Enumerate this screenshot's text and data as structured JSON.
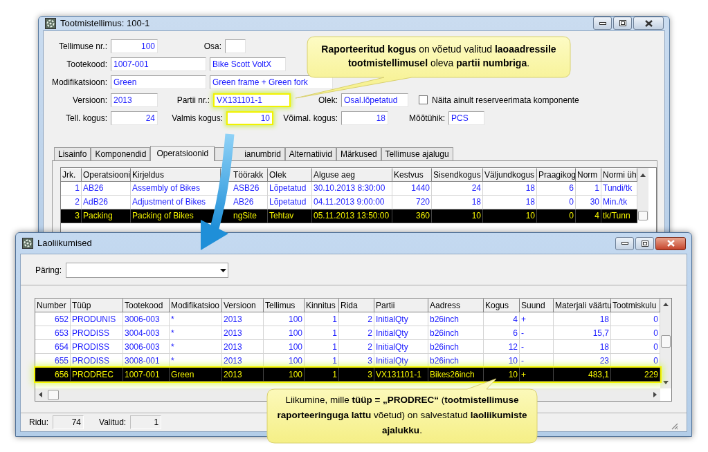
{
  "order_window": {
    "title": "Tootmistellimus: 100-1",
    "form": [
      [
        {
          "kind": "label",
          "text": "Tellimuse nr.:"
        },
        {
          "kind": "number",
          "value": "100",
          "highlighted": false
        },
        {
          "kind": "label",
          "text": "Osa:"
        },
        {
          "kind": "text",
          "highlighted": false
        }
      ],
      [
        {
          "kind": "label",
          "text": "Tootekood:"
        },
        {
          "kind": "text",
          "value": "1007-001",
          "highlighted": false
        },
        {
          "kind": "text",
          "value": "Bike Scott VoltX",
          "highlighted": false
        }
      ],
      [
        {
          "kind": "label",
          "text": "Modifikatsioon:"
        },
        {
          "kind": "text",
          "value": "Green",
          "highlighted": false
        },
        {
          "kind": "text",
          "value": "Green frame + Green fork",
          "highlighted": false
        }
      ],
      [
        {
          "kind": "label",
          "text": "Versioon:"
        },
        {
          "kind": "text",
          "value": "2013",
          "highlighted": false
        },
        {
          "kind": "label",
          "text": "Partii nr.:"
        },
        {
          "kind": "text",
          "value": "VX131101-1",
          "highlighted": true
        },
        {
          "kind": "label",
          "text": "Olek:"
        },
        {
          "kind": "text",
          "value": "Osal.lõpetatud",
          "highlighted": false
        },
        {
          "kind": "checkbox",
          "text": "Näita ainult reserveerimata komponente",
          "checked": false
        }
      ],
      [
        {
          "kind": "label",
          "text": "Tell. kogus:"
        },
        {
          "kind": "number",
          "value": "24",
          "highlighted": false
        },
        {
          "kind": "label",
          "text": "Valmis kogus:"
        },
        {
          "kind": "number",
          "value": "10",
          "highlighted": true
        },
        {
          "kind": "label",
          "text": "Võimal. kogus:"
        },
        {
          "kind": "number",
          "value": "18",
          "highlighted": false
        },
        {
          "kind": "label",
          "text": "Mõõtühik:"
        },
        {
          "kind": "text",
          "value": "PCS",
          "highlighted": false
        }
      ]
    ],
    "tabs": [
      {
        "label": "Lisainfo",
        "selected": false
      },
      {
        "label": "Komponendid",
        "selected": false
      },
      {
        "label": "Operatsioonid",
        "selected": true
      },
      {
        "label": "ianumbrid",
        "selected": false
      },
      {
        "label": "Alternatiivid",
        "selected": false
      },
      {
        "label": "Märkused",
        "selected": false
      },
      {
        "label": "Tellimuse ajalugu",
        "selected": false
      }
    ],
    "operations": {
      "columns": [
        "Jrk.",
        "Operatsiooni",
        "Kirjeldus",
        "Töörakk",
        "Olek",
        "Alguse aeg",
        "Kestvus",
        "Sisendkogus",
        "Väljundkogus",
        "Praagikog",
        "Norm",
        "Normi üh"
      ],
      "rows": [
        {
          "selected": false,
          "cells": [
            "1",
            "AB26",
            "Assembly of Bikes",
            "ASB26",
            "Lõpetatud",
            "30.10.2013 8:30:00",
            "1440",
            "24",
            "18",
            "6",
            "1",
            "Tundi/tk"
          ]
        },
        {
          "selected": false,
          "cells": [
            "2",
            "AdB26",
            "Adjustment of Bikes",
            "AB26",
            "Lõpetatud",
            "04.11.2013 9:00:00",
            "720",
            "18",
            "18",
            "0",
            "30",
            "Min./tk"
          ]
        },
        {
          "selected": true,
          "cells": [
            "3",
            "Packing",
            "Packing of Bikes",
            "ngSite",
            "Tehtav",
            "05.11.2013 13:50:00",
            "360",
            "10",
            "10",
            "0",
            "4",
            "tk/Tunn"
          ]
        }
      ]
    }
  },
  "order_callout": "**Raporteeritud kogus** on võetud valitud **laoaadressile tootmistellimusel** oleva **partii numbriga**.",
  "movements_window": {
    "title": "Laoliikumised",
    "query_label": "Päring:",
    "columns": [
      "Number",
      "Tüüp",
      "Tootekood",
      "Modifikatsioo",
      "Versioon",
      "Tellimus",
      "Kinnitus",
      "Rida",
      "Partii",
      "Aadress",
      "Kogus",
      "Suund",
      "Materjali väärtu",
      "Tootmiskulu"
    ],
    "rows": [
      {
        "selected": false,
        "highlighted": false,
        "cells": [
          "652",
          "PRODUNIS",
          "3006-003",
          "*",
          "2013",
          "100",
          "1",
          "2",
          "InitialQty",
          "b26inch",
          "4",
          "+",
          "18",
          "0"
        ]
      },
      {
        "selected": false,
        "highlighted": false,
        "cells": [
          "653",
          "PRODISS",
          "3004-003",
          "*",
          "2013",
          "100",
          "1",
          "2",
          "InitialQty",
          "b26inch",
          "6",
          "-",
          "15,7",
          "0"
        ]
      },
      {
        "selected": false,
        "highlighted": false,
        "cells": [
          "654",
          "PRODISS",
          "3006-003",
          "*",
          "2013",
          "100",
          "1",
          "2",
          "InitialQty",
          "b26inch",
          "12",
          "-",
          "18",
          "0"
        ]
      },
      {
        "selected": false,
        "highlighted": false,
        "cells": [
          "655",
          "PRODISS",
          "3008-001",
          "*",
          "2013",
          "100",
          "1",
          "3",
          "InitialQty",
          "b26inch",
          "10",
          "-",
          "23",
          "0"
        ]
      },
      {
        "selected": true,
        "highlighted": true,
        "cells": [
          "656",
          "PRODREC",
          "1007-001",
          "Green",
          "2013",
          "100",
          "1",
          "3",
          "VX131101-1",
          "Bikes26inch",
          "10",
          "+",
          "483,1",
          "229"
        ]
      }
    ],
    "status": [
      {
        "label": "Ridu:",
        "value": "74"
      },
      {
        "label": "Valitud:",
        "value": "1"
      }
    ]
  },
  "movement_callout": "Liikumine, mille **tüüp = „PRODREC“** (**tootmistellimuse raporteeringuga lattu** võetud) on salvestatud **laoliikumiste ajalukku**."
}
